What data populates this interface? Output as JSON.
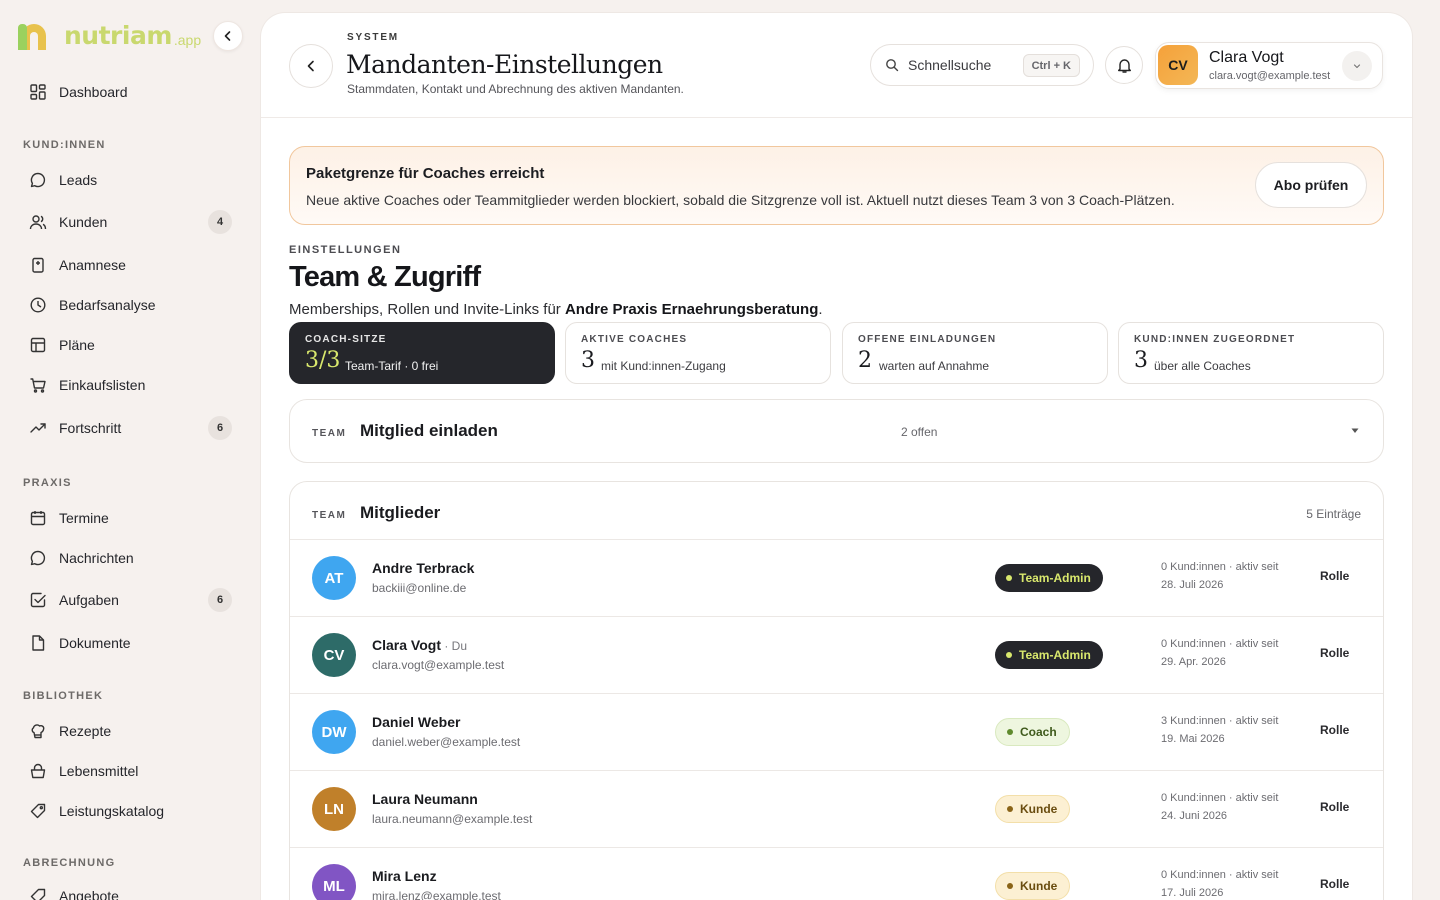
{
  "brand": {
    "name": "nutriam",
    "suffix": ".app"
  },
  "sidebar": {
    "dashboard": "Dashboard",
    "section_clients": "KUND:INNEN",
    "leads": "Leads",
    "kunden": "Kunden",
    "kunden_badge": "4",
    "anamnese": "Anamnese",
    "bedarfsanalyse": "Bedarfsanalyse",
    "plaene": "Pläne",
    "einkaufslisten": "Einkaufslisten",
    "fortschritt": "Fortschritt",
    "fortschritt_badge": "6",
    "section_practice": "PRAXIS",
    "termine": "Termine",
    "nachrichten": "Nachrichten",
    "aufgaben": "Aufgaben",
    "aufgaben_badge": "6",
    "dokumente": "Dokumente",
    "section_library": "BIBLIOTHEK",
    "rezepte": "Rezepte",
    "lebensmittel": "Lebensmittel",
    "leistungskatalog": "Leistungskatalog",
    "section_billing": "ABRECHNUNG",
    "angebote": "Angebote"
  },
  "header": {
    "eyebrow": "SYSTEM",
    "title": "Mandanten-Einstellungen",
    "subtitle": "Stammdaten, Kontakt und Abrechnung des aktiven Mandanten.",
    "search_placeholder": "Schnellsuche",
    "search_kbd": "Ctrl + K",
    "user_initials": "CV",
    "user_name": "Clara Vogt",
    "user_email": "clara.vogt@example.test"
  },
  "alert": {
    "title": "Paketgrenze für Coaches erreicht",
    "text": "Neue aktive Coaches oder Teammitglieder werden blockiert, sobald die Sitzgrenze voll ist. Aktuell nutzt dieses Team 3 von 3 Coach-Plätzen.",
    "button": "Abo prüfen"
  },
  "section": {
    "eyebrow": "EINSTELLUNGEN",
    "title": "Team & Zugriff",
    "sub_prefix": "Memberships, Rollen und Invite-Links für ",
    "sub_org": "Andre Praxis Ernaehrungsberatung",
    "sub_suffix": "."
  },
  "stats": [
    {
      "label": "COACH-SITZE",
      "value": "3/3",
      "desc": "Team-Tarif · 0 frei"
    },
    {
      "label": "AKTIVE COACHES",
      "value": "3",
      "desc": "mit Kund:innen-Zugang"
    },
    {
      "label": "OFFENE EINLADUNGEN",
      "value": "2",
      "desc": "warten auf Annahme"
    },
    {
      "label": "KUND:INNEN ZUGEORDNET",
      "value": "3",
      "desc": "über alle Coaches"
    }
  ],
  "invite": {
    "eyebrow": "TEAM",
    "title": "Mitglied einladen",
    "meta": "2 offen"
  },
  "members_card": {
    "eyebrow": "TEAM",
    "title": "Mitglieder",
    "meta": "5 Einträge"
  },
  "members": [
    {
      "initials": "AT",
      "name": "Andre Terbrack",
      "you": "",
      "email": "backiii@online.de",
      "role": "Team-Admin",
      "stat1": "0 Kund:innen · aktiv seit",
      "stat2": "28. Juli 2026",
      "action": "Rolle",
      "color": "#3fa6f0"
    },
    {
      "initials": "CV",
      "name": "Clara Vogt",
      "you": " · Du",
      "email": "clara.vogt@example.test",
      "role": "Team-Admin",
      "stat1": "0 Kund:innen · aktiv seit",
      "stat2": "29. Apr. 2026",
      "action": "Rolle",
      "color": "#2d6b68"
    },
    {
      "initials": "DW",
      "name": "Daniel Weber",
      "you": "",
      "email": "daniel.weber@example.test",
      "role": "Coach",
      "stat1": "3 Kund:innen · aktiv seit",
      "stat2": "19. Mai 2026",
      "action": "Rolle",
      "color": "#3fa6f0"
    },
    {
      "initials": "LN",
      "name": "Laura Neumann",
      "you": "",
      "email": "laura.neumann@example.test",
      "role": "Kunde",
      "stat1": "0 Kund:innen · aktiv seit",
      "stat2": "24. Juni 2026",
      "action": "Rolle",
      "color": "#c0802a"
    },
    {
      "initials": "ML",
      "name": "Mira Lenz",
      "you": "",
      "email": "mira.lenz@example.test",
      "role": "Kunde",
      "stat1": "0 Kund:innen · aktiv seit",
      "stat2": "17. Juli 2026",
      "action": "Rolle",
      "color": "#8155c4"
    }
  ]
}
